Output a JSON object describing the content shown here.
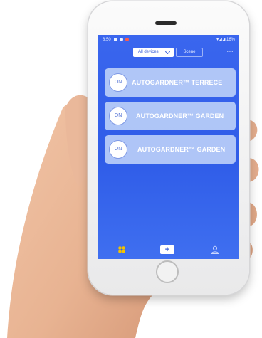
{
  "status_bar": {
    "time": "8:50",
    "right": "▾◢◢ 16%"
  },
  "tabs": {
    "all_devices": "All devices",
    "scene": "Scene"
  },
  "more_label": "···",
  "devices": [
    {
      "toggle_label": "ON",
      "name": "AUTOGARDNER™ TERRECE"
    },
    {
      "toggle_label": "ON",
      "name": "AUTOGARDNER™ GARDEN"
    },
    {
      "toggle_label": "ON",
      "name": "AUTOGARDNER™ GARDEN"
    }
  ],
  "bottom_nav": {
    "add_label": "+",
    "home_icon": "grid-flower-icon",
    "user_icon": "user-icon"
  },
  "colors": {
    "screen_top": "#3a66ee",
    "screen_bottom": "#3f6ff0",
    "card_bg": "#b9cdf8",
    "home_icon_color": "#f2c200"
  }
}
